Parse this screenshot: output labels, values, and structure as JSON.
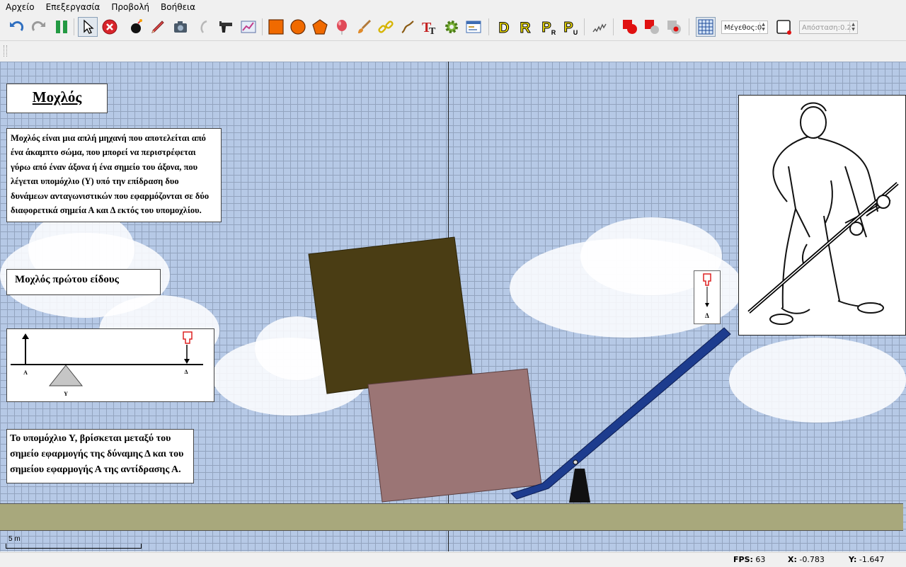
{
  "menu": [
    "Αρχείο",
    "Επεξεργασία",
    "Προβολή",
    "Βοήθεια"
  ],
  "toolbar": {
    "size_label": "Μέγεθος:0",
    "distance_label": "Απόσταση:0.2",
    "letters": {
      "d": "D",
      "r": "R",
      "pr": "P",
      "pu": "P",
      "pr_sub": "R",
      "pu_sub": "U"
    }
  },
  "scene": {
    "title": "Μοχλός",
    "definition": "Μοχλός είναι μια απλή μηχανή που αποτελείται από ένα άκαμπτο σώμα, που μπορεί να περιστρέφεται γύρω από έναν άξονα ή ένα σημείο του άξονα, που λέγεται υπομόχλιο (Υ) υπό την επίδραση δυο δυνάμεων ανταγωνιστικών που εφαρμόζονται σε δύο διαφορετικά σημεία Α και Δ εκτός του υπομοχλίου.",
    "first_kind": "Μοχλός πρώτου είδους",
    "diagram": {
      "a": "Α",
      "d": "Δ",
      "y": "Υ"
    },
    "fulcrum_note": "Το υπομόχλιο Υ, βρίσκεται μεταξύ του σημείο εφαρμογής της δύναμης Δ και του σημείου εφαρμογής Α της αντίδρασης Α.",
    "force_label": "Δ",
    "scale_label": "5 m",
    "colors": {
      "grid": "#93a4bf",
      "sky": "#b6c9e6",
      "ground": "#a8a87c",
      "box_dark": "#4a3d14",
      "box_pink": "#9b7575",
      "lever": "#1d3c8e"
    }
  },
  "status": {
    "fps_label": "FPS:",
    "fps": "63",
    "x_label": "X:",
    "x": "-0.783",
    "y_label": "Y:",
    "y": "-1.647"
  }
}
